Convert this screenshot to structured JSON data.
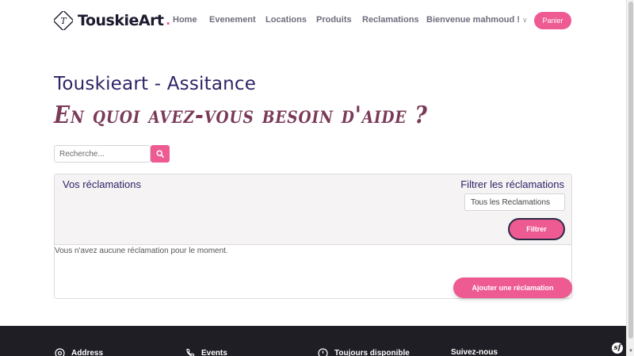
{
  "brand": {
    "name": "TouskieArt",
    "dot": "."
  },
  "nav": {
    "items": [
      "Home",
      "Evenement",
      "Locations",
      "Produits",
      "Reclamations"
    ],
    "user_menu": "Bienvenue mahmoud !",
    "cart_label": "Panier"
  },
  "page": {
    "title": "Touskieart - Assitance",
    "subtitle": "En quoi avez-vous besoin d'aide ?"
  },
  "search": {
    "placeholder": "Recherche..."
  },
  "card": {
    "title": "Vos réclamations",
    "filter_title": "Filtrer les réclamations",
    "filter_selected": "Tous les Reclamations",
    "filter_button": "Filtrer",
    "empty_message": "Vous n'avez aucune réclamation pour le moment.",
    "add_button": "Ajouter une réclamation"
  },
  "footer": {
    "items": [
      "Address",
      "Events",
      "Toujours disponible",
      "Suivez-nous"
    ]
  },
  "colors": {
    "accent": "#ee5a92",
    "heading": "#2d2466",
    "subtitle": "#7a3a58",
    "footer_bg": "#1e1e24"
  }
}
